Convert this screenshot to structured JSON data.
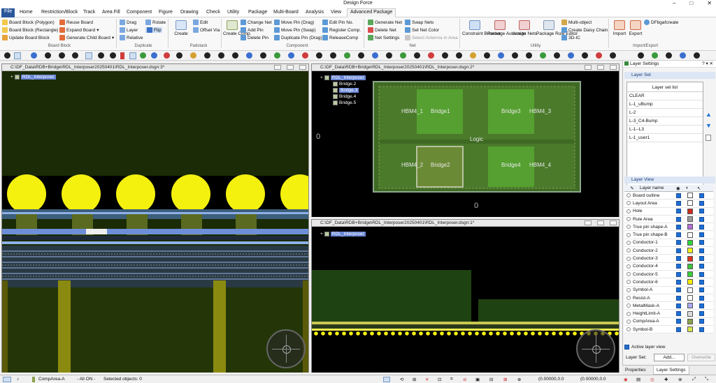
{
  "window": {
    "title": "Design Force"
  },
  "menu": {
    "tabs": [
      "File",
      "Home",
      "Restriction/Block",
      "Track",
      "Area Fill",
      "Component",
      "Figure",
      "Drawing",
      "Check",
      "Utility",
      "Package",
      "Multi-Board",
      "Analysis",
      "View",
      "Advanced Package"
    ]
  },
  "ribbon": {
    "board_block": {
      "group": "Board Block",
      "items": [
        "Board Block (Polygon)",
        "Board Block (Rectangle)",
        "Update Board Block",
        "Reuse Board",
        "Expand Board",
        "Generate Child Board"
      ]
    },
    "duplicate": {
      "group": "Duplicate",
      "items": [
        "Drag",
        "Layer",
        "Relative",
        "Rotate",
        "Flip"
      ]
    },
    "padstack": {
      "group": "Padstack",
      "create": "Create",
      "edit": "Edit",
      "offset_via": "Offset Via"
    },
    "component": {
      "group": "Component",
      "create_comp": "Create Comp.",
      "items": [
        "Change Net",
        "Add Pin",
        "Delete Pin",
        "Move Pin (Drag)",
        "Move Pin (Swap)",
        "Duplicate Pin (Drag)",
        "Edit Pin No.",
        "Register Comp.",
        "ReleaseComp"
      ]
    },
    "net": {
      "group": "Net",
      "items": [
        "Generate Net",
        "Delete Net",
        "Net Settings",
        "Swap Nets",
        "Set Net Color",
        "Select Antenna in Area"
      ]
    },
    "utility": {
      "group": "Utility",
      "items": [
        "Constraint Browser",
        "Package Autoroute",
        "Assign Nets",
        "Package Rule Editor",
        "Multi-object",
        "Create Daisy Chain",
        "3D-IC"
      ]
    },
    "import_export": {
      "group": "Import/Export",
      "items": [
        "Import",
        "Export",
        "DFbgafcreate"
      ]
    }
  },
  "panes": {
    "left": {
      "path": "C:\\DF_Data\\RDB+Bridge\\RDL_Interposer20250401\\RDL_Interposer.dsgn:3*",
      "tree": [
        "RDL_Interposer"
      ]
    },
    "top_right": {
      "path": "C:\\DF_Data\\RDB+Bridge\\RDL_Interposer20250401\\RDL_Interposer.dsgn:2*",
      "tree": [
        "RDL_Interposer",
        "Bridge.2",
        "Bridge.3",
        "Bridge.4",
        "Bridge.5"
      ],
      "labels": [
        "HBM4_1",
        "Bridge1",
        "Bridge3",
        "HBM4_3",
        "Logic",
        "HBM4_2",
        "Bridge2",
        "Bridge4",
        "HBM4_4"
      ],
      "axis_zero_left": "0",
      "axis_zero_bottom": "0"
    },
    "bottom_right": {
      "path": "C:\\DF_Data\\RDB+Bridge\\RDL_Interposer20250401\\RDL_Interposer.dsgn:1*",
      "tree": [
        "RDL_Interposer"
      ]
    }
  },
  "sidebar": {
    "title": "Layer Settings",
    "layer_set": {
      "heading": "Layer Set",
      "list_title": "Layer set list",
      "items": [
        "CLEAR",
        "L-1_uBump",
        "L-2",
        "L-3_C4-Bump",
        "L-1--L3",
        "L-1_user1"
      ]
    },
    "layer_view": {
      "heading": "Layer View",
      "col_name": "Layer name",
      "layers": [
        {
          "name": "Board outline",
          "color": "#ffffff"
        },
        {
          "name": "Layout Area",
          "color": "#ffffff"
        },
        {
          "name": "Hole",
          "color": "#cc2a1f"
        },
        {
          "name": "Rule Area",
          "color": "#9a9a9a"
        },
        {
          "name": "True pin shape-A",
          "color": "#b56fd6"
        },
        {
          "name": "True pin shape-B",
          "color": "#ffffff"
        },
        {
          "name": "Conductor-1",
          "color": "#2fd63b"
        },
        {
          "name": "Conductor-2",
          "color": "#f2f21e"
        },
        {
          "name": "Conductor-3",
          "color": "#e2321d"
        },
        {
          "name": "Conductor-4",
          "color": "#3ec13e"
        },
        {
          "name": "Conductor-5",
          "color": "#3ad03a"
        },
        {
          "name": "Conductor-6",
          "color": "#f8f000"
        },
        {
          "name": "Symbol-A",
          "color": "#ffffff"
        },
        {
          "name": "Resist-A",
          "color": "#ffffff"
        },
        {
          "name": "MetalMask-A",
          "color": "#a9a9f2"
        },
        {
          "name": "HeightLimit-A",
          "color": "#dcdcdc"
        },
        {
          "name": "CompArea-A",
          "color": "#8aa24c"
        },
        {
          "name": "Symbol-B",
          "color": "#d8e64a"
        }
      ],
      "active_layer_view": "Active layer view",
      "layer_set_label": "Layer Set:",
      "add_button": "Add...",
      "overwrite_button": "Overwrite"
    },
    "bottom_tabs": [
      "Properties",
      "Layer Settings"
    ]
  },
  "status": {
    "active_layer": "CompArea-A",
    "mode": "- All ON -",
    "selected": "Selected objects: 0",
    "coords_1": "(0.00000,0.0",
    "coords_2": "(0.00000,0.0"
  }
}
